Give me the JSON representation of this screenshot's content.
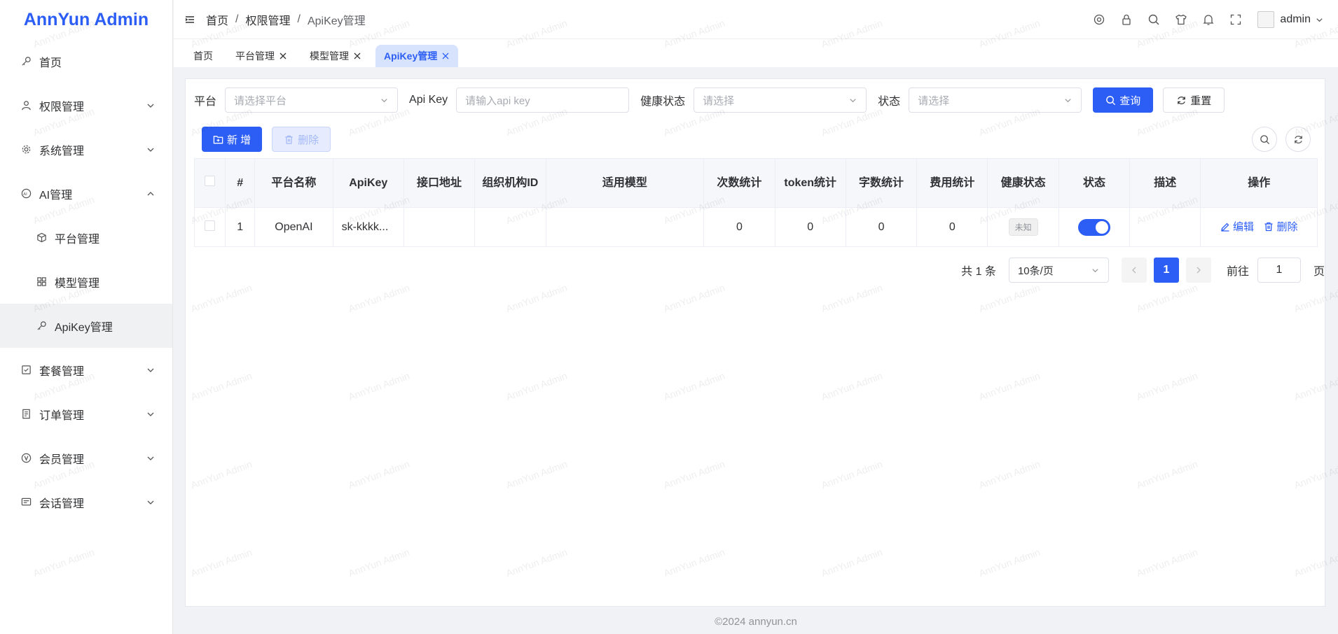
{
  "app": {
    "logo": "AnnYun Admin",
    "watermark": "AnnYun Admin"
  },
  "sidebar": {
    "items": [
      {
        "label": "首页",
        "icon": "key-icon"
      },
      {
        "label": "权限管理",
        "icon": "user-icon"
      },
      {
        "label": "系统管理",
        "icon": "gear-icon"
      },
      {
        "label": "AI管理",
        "icon": "ai-icon"
      },
      {
        "label": "平台管理",
        "icon": "cube-icon"
      },
      {
        "label": "模型管理",
        "icon": "grid-icon"
      },
      {
        "label": "ApiKey管理",
        "icon": "key-icon"
      },
      {
        "label": "套餐管理",
        "icon": "package-icon"
      },
      {
        "label": "订单管理",
        "icon": "receipt-icon"
      },
      {
        "label": "会员管理",
        "icon": "vip-icon"
      },
      {
        "label": "会话管理",
        "icon": "chat-icon"
      }
    ]
  },
  "header": {
    "breadcrumb": [
      "首页",
      "权限管理",
      "ApiKey管理"
    ],
    "username": "admin"
  },
  "tabs": [
    "首页",
    "平台管理",
    "模型管理",
    "ApiKey管理"
  ],
  "filters": {
    "platform_label": "平台",
    "platform_placeholder": "请选择平台",
    "apikey_label": "Api Key",
    "apikey_placeholder": "请输入api key",
    "health_label": "健康状态",
    "health_placeholder": "请选择",
    "status_label": "状态",
    "status_placeholder": "请选择",
    "query_label": "查询",
    "reset_label": "重置"
  },
  "toolbar": {
    "add_label": "新 增",
    "delete_label": "删除"
  },
  "table": {
    "columns": [
      "#",
      "平台名称",
      "ApiKey",
      "接口地址",
      "组织机构ID",
      "适用模型",
      "次数统计",
      "token统计",
      "字数统计",
      "费用统计",
      "健康状态",
      "状态",
      "描述",
      "操作"
    ],
    "rows": [
      {
        "index": "1",
        "platform": "OpenAI",
        "apikey": "sk-kkkk...",
        "endpoint": "",
        "org_id": "",
        "models": "",
        "count": "0",
        "tokens": "0",
        "chars": "0",
        "cost": "0",
        "health": "未知",
        "status_on": true,
        "desc": "",
        "edit_label": "编辑",
        "delete_label": "删除"
      }
    ]
  },
  "pagination": {
    "total": "共 1 条",
    "page_size": "10条/页",
    "current": "1",
    "goto_label": "前往",
    "goto_value": "1",
    "page_suffix": "页"
  },
  "footer": "©2024 annyun.cn",
  "colors": {
    "accent": "#2c5ef5",
    "active_tab_bg": "#d7e3fd"
  }
}
